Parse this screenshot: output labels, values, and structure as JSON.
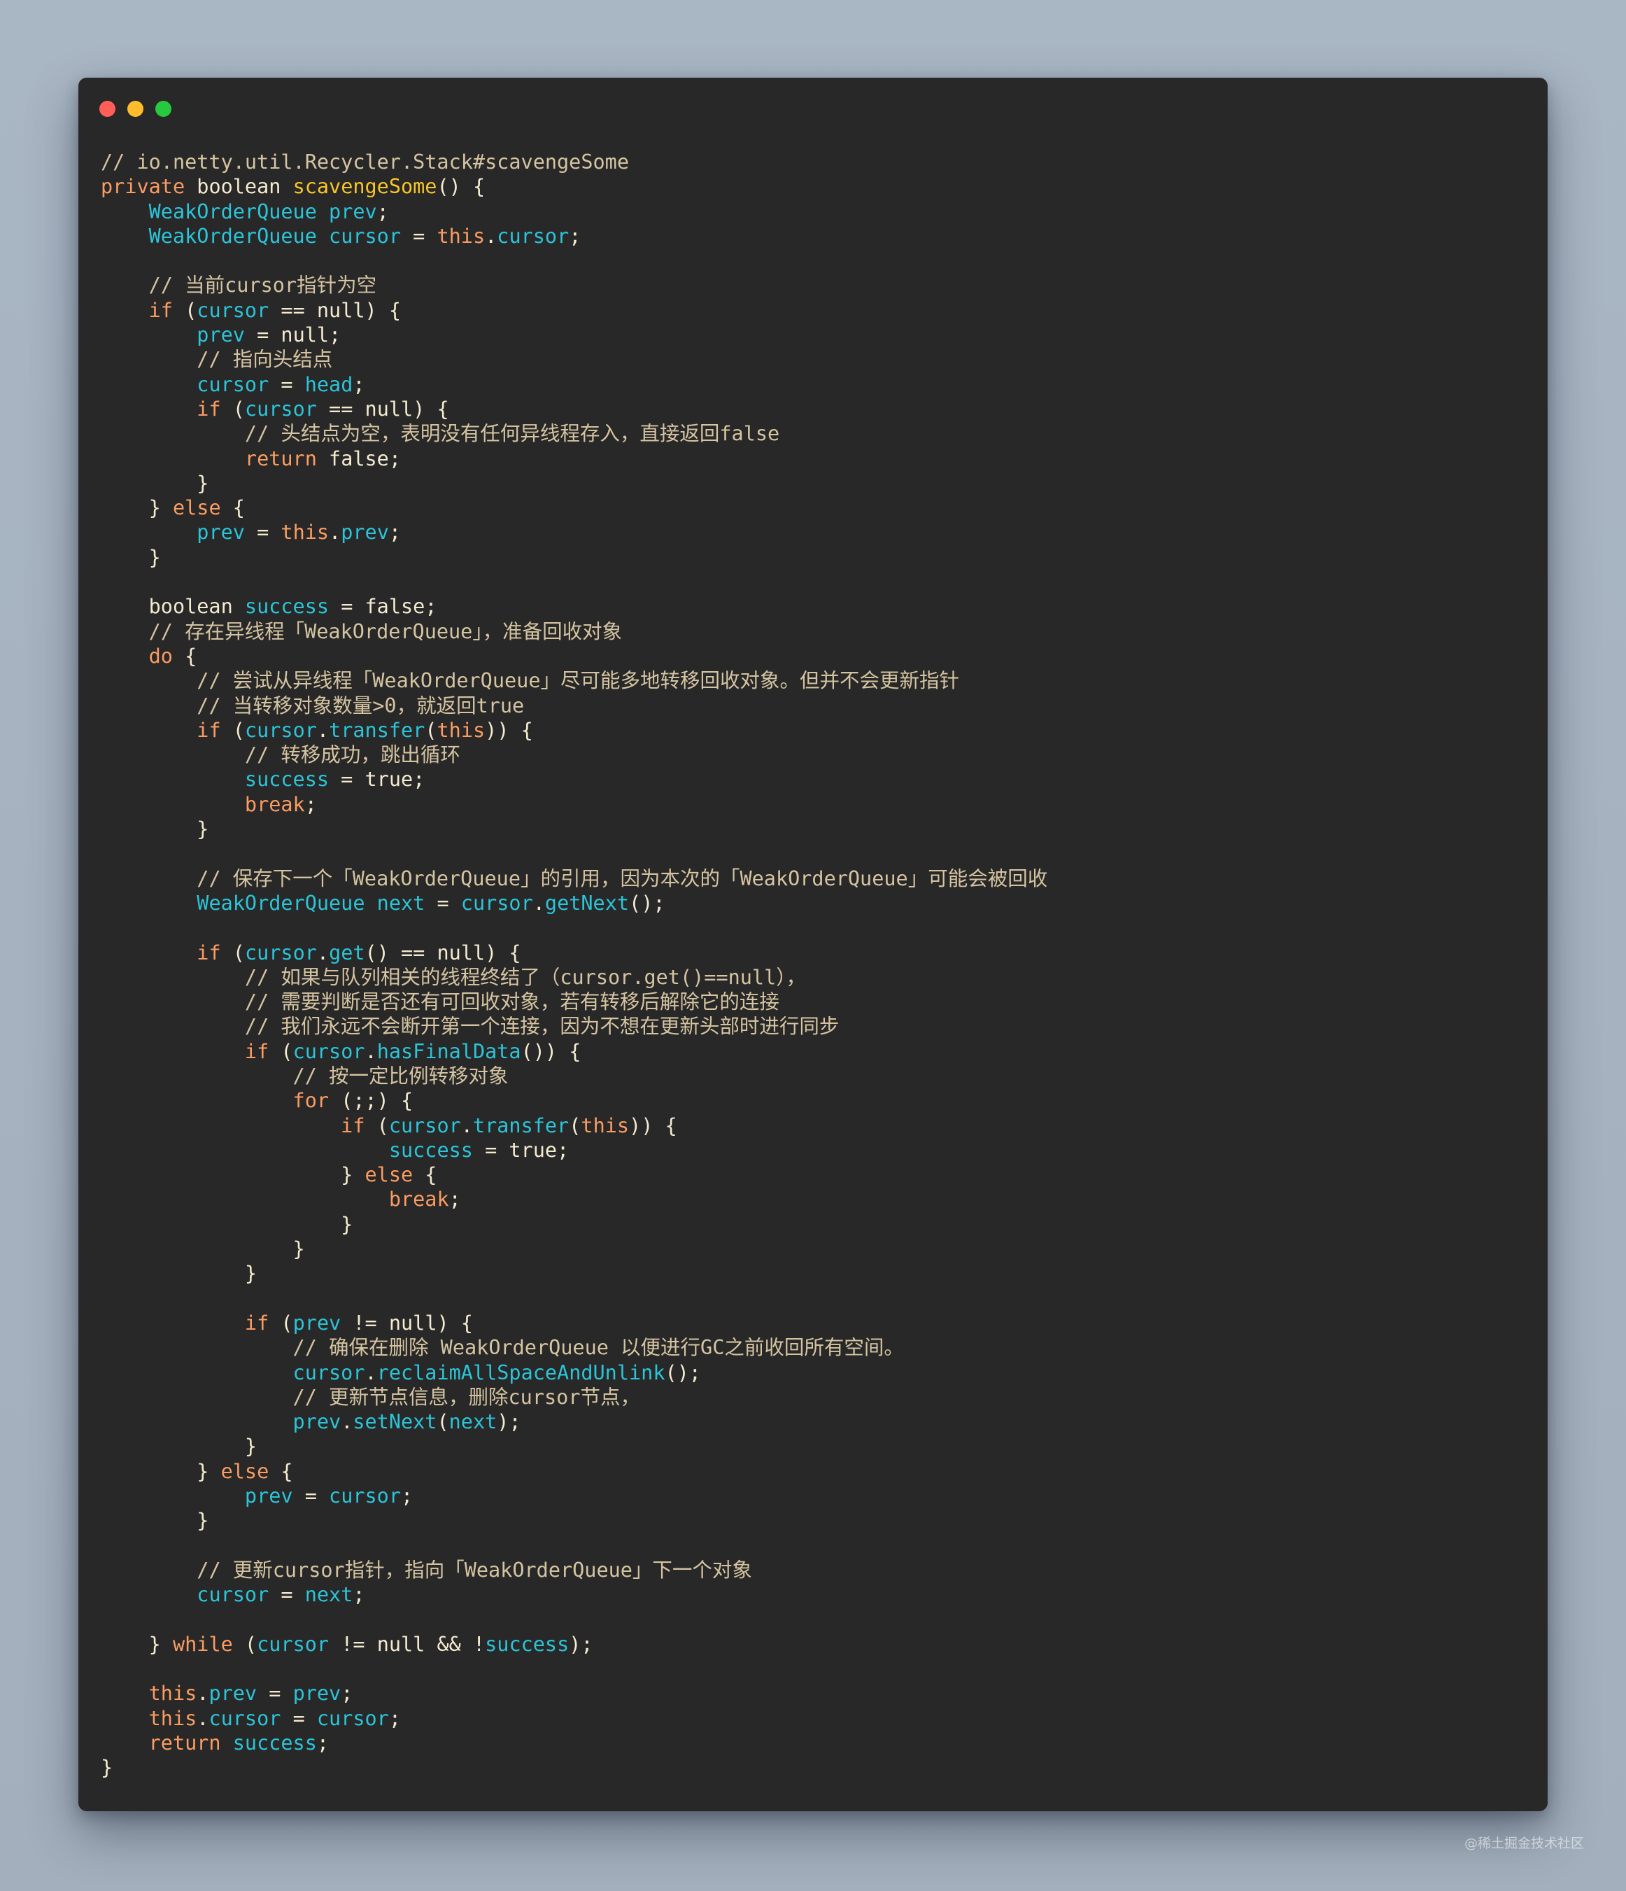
{
  "window": {
    "traffic_lights": [
      {
        "name": "close-button",
        "color": "#ff5f56"
      },
      {
        "name": "minimize-button",
        "color": "#ffbd2e"
      },
      {
        "name": "zoom-button",
        "color": "#27c93f"
      }
    ]
  },
  "palette": {
    "background": "#282828",
    "comment": "#d5c4a1",
    "keyword": "#fb9c62",
    "type": "#f4ead0",
    "identifier": "#2bc4d8",
    "function": "#f9c527",
    "literal": "#f4ead0"
  },
  "code": {
    "language": "java",
    "lines": [
      [
        [
          "com",
          "// io.netty.util.Recycler.Stack#scavengeSome"
        ]
      ],
      [
        [
          "kw",
          "private"
        ],
        [
          "txt",
          " "
        ],
        [
          "type",
          "boolean"
        ],
        [
          "txt",
          " "
        ],
        [
          "fn",
          "scavengeSome"
        ],
        [
          "pun",
          "() {"
        ]
      ],
      [
        [
          "txt",
          "    "
        ],
        [
          "id",
          "WeakOrderQueue"
        ],
        [
          "txt",
          " "
        ],
        [
          "id",
          "prev"
        ],
        [
          "pun",
          ";"
        ]
      ],
      [
        [
          "txt",
          "    "
        ],
        [
          "id",
          "WeakOrderQueue"
        ],
        [
          "txt",
          " "
        ],
        [
          "id",
          "cursor"
        ],
        [
          "pun",
          " = "
        ],
        [
          "kw",
          "this"
        ],
        [
          "pun",
          "."
        ],
        [
          "id",
          "cursor"
        ],
        [
          "pun",
          ";"
        ]
      ],
      [],
      [
        [
          "txt",
          "    "
        ],
        [
          "com",
          "// 当前cursor指针为空"
        ]
      ],
      [
        [
          "txt",
          "    "
        ],
        [
          "kw",
          "if"
        ],
        [
          "pun",
          " ("
        ],
        [
          "id",
          "cursor"
        ],
        [
          "pun",
          " == "
        ],
        [
          "lit",
          "null"
        ],
        [
          "pun",
          ") {"
        ]
      ],
      [
        [
          "txt",
          "        "
        ],
        [
          "id",
          "prev"
        ],
        [
          "pun",
          " = "
        ],
        [
          "lit",
          "null"
        ],
        [
          "pun",
          ";"
        ]
      ],
      [
        [
          "txt",
          "        "
        ],
        [
          "com",
          "// 指向头结点"
        ]
      ],
      [
        [
          "txt",
          "        "
        ],
        [
          "id",
          "cursor"
        ],
        [
          "pun",
          " = "
        ],
        [
          "id",
          "head"
        ],
        [
          "pun",
          ";"
        ]
      ],
      [
        [
          "txt",
          "        "
        ],
        [
          "kw",
          "if"
        ],
        [
          "pun",
          " ("
        ],
        [
          "id",
          "cursor"
        ],
        [
          "pun",
          " == "
        ],
        [
          "lit",
          "null"
        ],
        [
          "pun",
          ") {"
        ]
      ],
      [
        [
          "txt",
          "            "
        ],
        [
          "com",
          "// 头结点为空，表明没有任何异线程存入，直接返回false"
        ]
      ],
      [
        [
          "txt",
          "            "
        ],
        [
          "kw",
          "return"
        ],
        [
          "txt",
          " "
        ],
        [
          "lit",
          "false"
        ],
        [
          "pun",
          ";"
        ]
      ],
      [
        [
          "txt",
          "        "
        ],
        [
          "pun",
          "}"
        ]
      ],
      [
        [
          "txt",
          "    "
        ],
        [
          "pun",
          "} "
        ],
        [
          "kw",
          "else"
        ],
        [
          "pun",
          " {"
        ]
      ],
      [
        [
          "txt",
          "        "
        ],
        [
          "id",
          "prev"
        ],
        [
          "pun",
          " = "
        ],
        [
          "kw",
          "this"
        ],
        [
          "pun",
          "."
        ],
        [
          "id",
          "prev"
        ],
        [
          "pun",
          ";"
        ]
      ],
      [
        [
          "txt",
          "    "
        ],
        [
          "pun",
          "}"
        ]
      ],
      [],
      [
        [
          "txt",
          "    "
        ],
        [
          "type",
          "boolean"
        ],
        [
          "txt",
          " "
        ],
        [
          "id",
          "success"
        ],
        [
          "pun",
          " = "
        ],
        [
          "lit",
          "false"
        ],
        [
          "pun",
          ";"
        ]
      ],
      [
        [
          "txt",
          "    "
        ],
        [
          "com",
          "// 存在异线程「WeakOrderQueue」，准备回收对象"
        ]
      ],
      [
        [
          "txt",
          "    "
        ],
        [
          "kw",
          "do"
        ],
        [
          "pun",
          " {"
        ]
      ],
      [
        [
          "txt",
          "        "
        ],
        [
          "com",
          "// 尝试从异线程「WeakOrderQueue」尽可能多地转移回收对象。但并不会更新指针"
        ]
      ],
      [
        [
          "txt",
          "        "
        ],
        [
          "com",
          "// 当转移对象数量>0，就返回true"
        ]
      ],
      [
        [
          "txt",
          "        "
        ],
        [
          "kw",
          "if"
        ],
        [
          "pun",
          " ("
        ],
        [
          "id",
          "cursor"
        ],
        [
          "pun",
          "."
        ],
        [
          "id",
          "transfer"
        ],
        [
          "pun",
          "("
        ],
        [
          "kw",
          "this"
        ],
        [
          "pun",
          ")) {"
        ]
      ],
      [
        [
          "txt",
          "            "
        ],
        [
          "com",
          "// 转移成功，跳出循环"
        ]
      ],
      [
        [
          "txt",
          "            "
        ],
        [
          "id",
          "success"
        ],
        [
          "pun",
          " = "
        ],
        [
          "lit",
          "true"
        ],
        [
          "pun",
          ";"
        ]
      ],
      [
        [
          "txt",
          "            "
        ],
        [
          "kw",
          "break"
        ],
        [
          "pun",
          ";"
        ]
      ],
      [
        [
          "txt",
          "        "
        ],
        [
          "pun",
          "}"
        ]
      ],
      [],
      [
        [
          "txt",
          "        "
        ],
        [
          "com",
          "// 保存下一个「WeakOrderQueue」的引用，因为本次的「WeakOrderQueue」可能会被回收"
        ]
      ],
      [
        [
          "txt",
          "        "
        ],
        [
          "id",
          "WeakOrderQueue"
        ],
        [
          "txt",
          " "
        ],
        [
          "id",
          "next"
        ],
        [
          "pun",
          " = "
        ],
        [
          "id",
          "cursor"
        ],
        [
          "pun",
          "."
        ],
        [
          "id",
          "getNext"
        ],
        [
          "pun",
          "();"
        ]
      ],
      [],
      [
        [
          "txt",
          "        "
        ],
        [
          "kw",
          "if"
        ],
        [
          "pun",
          " ("
        ],
        [
          "id",
          "cursor"
        ],
        [
          "pun",
          "."
        ],
        [
          "id",
          "get"
        ],
        [
          "pun",
          "() == "
        ],
        [
          "lit",
          "null"
        ],
        [
          "pun",
          ") {"
        ]
      ],
      [
        [
          "txt",
          "            "
        ],
        [
          "com",
          "// 如果与队列相关的线程终结了（cursor.get()==null），"
        ]
      ],
      [
        [
          "txt",
          "            "
        ],
        [
          "com",
          "// 需要判断是否还有可回收对象，若有转移后解除它的连接"
        ]
      ],
      [
        [
          "txt",
          "            "
        ],
        [
          "com",
          "// 我们永远不会断开第一个连接，因为不想在更新头部时进行同步"
        ]
      ],
      [
        [
          "txt",
          "            "
        ],
        [
          "kw",
          "if"
        ],
        [
          "pun",
          " ("
        ],
        [
          "id",
          "cursor"
        ],
        [
          "pun",
          "."
        ],
        [
          "id",
          "hasFinalData"
        ],
        [
          "pun",
          "()) {"
        ]
      ],
      [
        [
          "txt",
          "                "
        ],
        [
          "com",
          "// 按一定比例转移对象"
        ]
      ],
      [
        [
          "txt",
          "                "
        ],
        [
          "kw",
          "for"
        ],
        [
          "pun",
          " (;;) {"
        ]
      ],
      [
        [
          "txt",
          "                    "
        ],
        [
          "kw",
          "if"
        ],
        [
          "pun",
          " ("
        ],
        [
          "id",
          "cursor"
        ],
        [
          "pun",
          "."
        ],
        [
          "id",
          "transfer"
        ],
        [
          "pun",
          "("
        ],
        [
          "kw",
          "this"
        ],
        [
          "pun",
          ")) {"
        ]
      ],
      [
        [
          "txt",
          "                        "
        ],
        [
          "id",
          "success"
        ],
        [
          "pun",
          " = "
        ],
        [
          "lit",
          "true"
        ],
        [
          "pun",
          ";"
        ]
      ],
      [
        [
          "txt",
          "                    "
        ],
        [
          "pun",
          "} "
        ],
        [
          "kw",
          "else"
        ],
        [
          "pun",
          " {"
        ]
      ],
      [
        [
          "txt",
          "                        "
        ],
        [
          "kw",
          "break"
        ],
        [
          "pun",
          ";"
        ]
      ],
      [
        [
          "txt",
          "                    "
        ],
        [
          "pun",
          "}"
        ]
      ],
      [
        [
          "txt",
          "                "
        ],
        [
          "pun",
          "}"
        ]
      ],
      [
        [
          "txt",
          "            "
        ],
        [
          "pun",
          "}"
        ]
      ],
      [],
      [
        [
          "txt",
          "            "
        ],
        [
          "kw",
          "if"
        ],
        [
          "pun",
          " ("
        ],
        [
          "id",
          "prev"
        ],
        [
          "pun",
          " != "
        ],
        [
          "lit",
          "null"
        ],
        [
          "pun",
          ") {"
        ]
      ],
      [
        [
          "txt",
          "                "
        ],
        [
          "com",
          "// 确保在删除 WeakOrderQueue 以便进行GC之前收回所有空间。"
        ]
      ],
      [
        [
          "txt",
          "                "
        ],
        [
          "id",
          "cursor"
        ],
        [
          "pun",
          "."
        ],
        [
          "id",
          "reclaimAllSpaceAndUnlink"
        ],
        [
          "pun",
          "();"
        ]
      ],
      [
        [
          "txt",
          "                "
        ],
        [
          "com",
          "// 更新节点信息，删除cursor节点，"
        ]
      ],
      [
        [
          "txt",
          "                "
        ],
        [
          "id",
          "prev"
        ],
        [
          "pun",
          "."
        ],
        [
          "id",
          "setNext"
        ],
        [
          "pun",
          "("
        ],
        [
          "id",
          "next"
        ],
        [
          "pun",
          ");"
        ]
      ],
      [
        [
          "txt",
          "            "
        ],
        [
          "pun",
          "}"
        ]
      ],
      [
        [
          "txt",
          "        "
        ],
        [
          "pun",
          "} "
        ],
        [
          "kw",
          "else"
        ],
        [
          "pun",
          " {"
        ]
      ],
      [
        [
          "txt",
          "            "
        ],
        [
          "id",
          "prev"
        ],
        [
          "pun",
          " = "
        ],
        [
          "id",
          "cursor"
        ],
        [
          "pun",
          ";"
        ]
      ],
      [
        [
          "txt",
          "        "
        ],
        [
          "pun",
          "}"
        ]
      ],
      [],
      [
        [
          "txt",
          "        "
        ],
        [
          "com",
          "// 更新cursor指针，指向「WeakOrderQueue」下一个对象"
        ]
      ],
      [
        [
          "txt",
          "        "
        ],
        [
          "id",
          "cursor"
        ],
        [
          "pun",
          " = "
        ],
        [
          "id",
          "next"
        ],
        [
          "pun",
          ";"
        ]
      ],
      [],
      [
        [
          "txt",
          "    "
        ],
        [
          "pun",
          "} "
        ],
        [
          "kw",
          "while"
        ],
        [
          "pun",
          " ("
        ],
        [
          "id",
          "cursor"
        ],
        [
          "pun",
          " != "
        ],
        [
          "lit",
          "null"
        ],
        [
          "pun",
          " && !"
        ],
        [
          "id",
          "success"
        ],
        [
          "pun",
          ");"
        ]
      ],
      [],
      [
        [
          "txt",
          "    "
        ],
        [
          "kw",
          "this"
        ],
        [
          "pun",
          "."
        ],
        [
          "id",
          "prev"
        ],
        [
          "pun",
          " = "
        ],
        [
          "id",
          "prev"
        ],
        [
          "pun",
          ";"
        ]
      ],
      [
        [
          "txt",
          "    "
        ],
        [
          "kw",
          "this"
        ],
        [
          "pun",
          "."
        ],
        [
          "id",
          "cursor"
        ],
        [
          "pun",
          " = "
        ],
        [
          "id",
          "cursor"
        ],
        [
          "pun",
          ";"
        ]
      ],
      [
        [
          "txt",
          "    "
        ],
        [
          "kw",
          "return"
        ],
        [
          "txt",
          " "
        ],
        [
          "id",
          "success"
        ],
        [
          "pun",
          ";"
        ]
      ],
      [
        [
          "pun",
          "}"
        ]
      ]
    ]
  },
  "watermark": {
    "text": "@稀土掘金技术社区"
  }
}
